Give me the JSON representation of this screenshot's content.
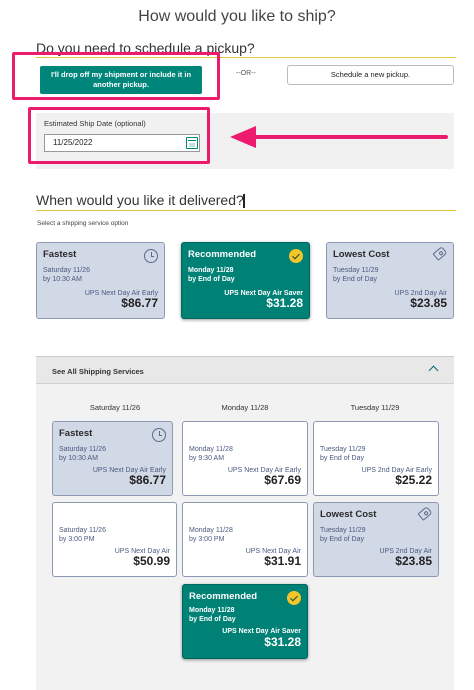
{
  "header": {
    "title": "How would you like to ship?"
  },
  "pickup": {
    "question": "Do you need to schedule a pickup?",
    "drop_off_label": "I'll drop off my shipment or include it in another pickup.",
    "or_label": "--OR--",
    "schedule_label": "Schedule a new pickup."
  },
  "ship_date": {
    "label": "Estimated Ship Date (optional)",
    "value": "11/25/2022"
  },
  "delivery": {
    "question": "When would you like it delivered?",
    "hint": "Select a shipping service option",
    "featured": [
      {
        "title": "Fastest",
        "date": "Saturday 11/26",
        "time": "by 10:30 AM",
        "service": "UPS Next Day Air Early",
        "price": "$86.77",
        "icon": "clock-icon"
      },
      {
        "title": "Recommended",
        "date": "Monday 11/28",
        "time": "by End of Day",
        "service": "UPS Next Day Air Saver",
        "price": "$31.28",
        "icon": "check-circle-icon"
      },
      {
        "title": "Lowest Cost",
        "date": "Tuesday 11/29",
        "time": "by End of Day",
        "service": "UPS 2nd Day Air",
        "price": "$23.85",
        "icon": "tag-icon"
      }
    ]
  },
  "all_services": {
    "title": "See All Shipping Services",
    "columns": [
      "Saturday  11/26",
      "Monday  11/28",
      "Tuesday  11/29"
    ],
    "cards": [
      {
        "title": "Fastest",
        "date": "Saturday 11/26",
        "time": "by 10:30 AM",
        "service": "UPS Next Day Air Early",
        "price": "$86.77"
      },
      {
        "title": "",
        "date": "Monday 11/28",
        "time": "by 9:30 AM",
        "service": "UPS Next Day Air Early",
        "price": "$67.69"
      },
      {
        "title": "",
        "date": "Tuesday 11/29",
        "time": "by End of Day",
        "service": "UPS 2nd Day Air Early",
        "price": "$25.22"
      },
      {
        "title": "",
        "date": "Saturday 11/26",
        "time": "by 3:00 PM",
        "service": "UPS Next Day Air",
        "price": "$50.99"
      },
      {
        "title": "",
        "date": "Monday 11/28",
        "time": "by 3:00 PM",
        "service": "UPS Next Day Air",
        "price": "$31.91"
      },
      {
        "title": "Lowest Cost",
        "date": "Tuesday 11/29",
        "time": "by End of Day",
        "service": "UPS 2nd Day Air",
        "price": "$23.85"
      },
      {
        "title": "Recommended",
        "date": "Monday 11/28",
        "time": "by End of Day",
        "service": "UPS Next Day Air Saver",
        "price": "$31.28"
      }
    ]
  },
  "colors": {
    "accent_green": "#00857b",
    "highlight_pink": "#ec1b6e",
    "rule_yellow": "#e3c63a",
    "card_blue": "#d1d8e6"
  }
}
